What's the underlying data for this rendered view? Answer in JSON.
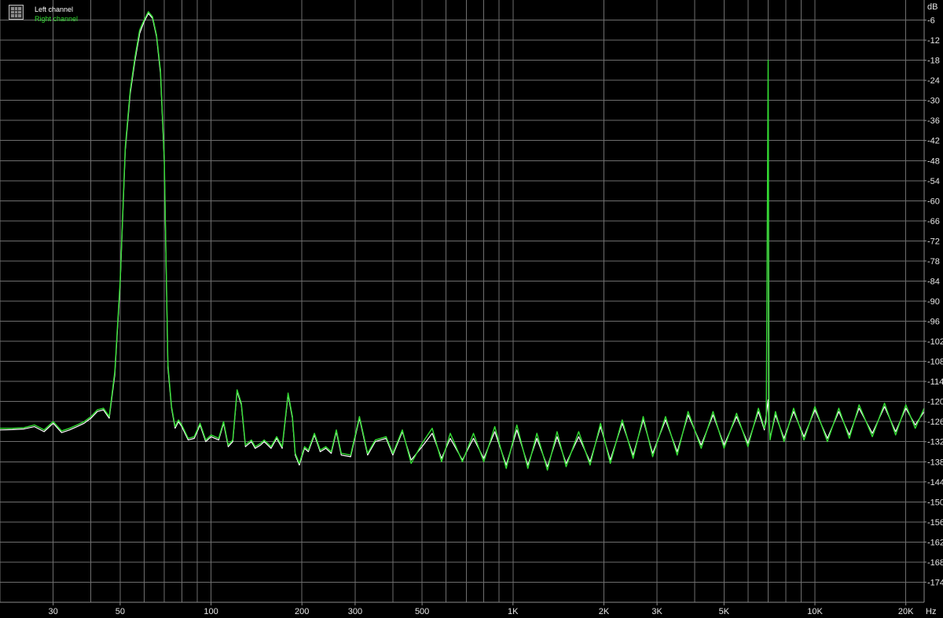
{
  "chart_data": {
    "type": "line",
    "x_scale": "log",
    "xlim": [
      20,
      23000
    ],
    "ylim": [
      -180,
      0
    ],
    "grid": true,
    "legend_position": "top-left",
    "xunit": "Hz",
    "yunit": "dB",
    "x_ticks": [
      {
        "value": 30,
        "label": "30"
      },
      {
        "value": 50,
        "label": "50"
      },
      {
        "value": 100,
        "label": "100"
      },
      {
        "value": 200,
        "label": "200"
      },
      {
        "value": 300,
        "label": "300"
      },
      {
        "value": 500,
        "label": "500"
      },
      {
        "value": 1000,
        "label": "1K"
      },
      {
        "value": 2000,
        "label": "2K"
      },
      {
        "value": 3000,
        "label": "3K"
      },
      {
        "value": 5000,
        "label": "5K"
      },
      {
        "value": 10000,
        "label": "10K"
      },
      {
        "value": 20000,
        "label": "20K"
      }
    ],
    "y_ticks": [
      -6,
      -12,
      -18,
      -24,
      -30,
      -36,
      -42,
      -48,
      -54,
      -60,
      -66,
      -72,
      -78,
      -84,
      -90,
      -96,
      -102,
      -108,
      -114,
      -120,
      -126,
      -132,
      -138,
      -144,
      -150,
      -156,
      -162,
      -168,
      -174
    ],
    "series": [
      {
        "name": "Left channel",
        "color": "#ffffff",
        "points": [
          [
            20,
            -128.5
          ],
          [
            22,
            -128.4
          ],
          [
            24,
            -128.2
          ],
          [
            26,
            -127.5
          ],
          [
            28,
            -129.0
          ],
          [
            30,
            -126.5
          ],
          [
            32,
            -129.3
          ],
          [
            34,
            -128.5
          ],
          [
            36,
            -127.5
          ],
          [
            38,
            -126.5
          ],
          [
            40,
            -125.0
          ],
          [
            42,
            -123.0
          ],
          [
            44,
            -122.5
          ],
          [
            46,
            -125.0
          ],
          [
            48,
            -112.0
          ],
          [
            50,
            -85.0
          ],
          [
            52,
            -45.0
          ],
          [
            54,
            -28.0
          ],
          [
            56,
            -18.0
          ],
          [
            58,
            -10.0
          ],
          [
            60,
            -6.5
          ],
          [
            62,
            -4.0
          ],
          [
            64,
            -5.5
          ],
          [
            66,
            -11.0
          ],
          [
            68,
            -22.0
          ],
          [
            70,
            -48.0
          ],
          [
            72,
            -110.0
          ],
          [
            74,
            -122.0
          ],
          [
            76,
            -128.0
          ],
          [
            78,
            -126.0
          ],
          [
            80,
            -127.5
          ],
          [
            84,
            -131.5
          ],
          [
            88,
            -131.0
          ],
          [
            92,
            -127.0
          ],
          [
            96,
            -132.0
          ],
          [
            100,
            -130.5
          ],
          [
            106,
            -131.5
          ],
          [
            110,
            -126.5
          ],
          [
            114,
            -133.5
          ],
          [
            118,
            -132.0
          ],
          [
            122,
            -117.0
          ],
          [
            126,
            -121.0
          ],
          [
            130,
            -133.5
          ],
          [
            136,
            -132.0
          ],
          [
            140,
            -134.0
          ],
          [
            146,
            -133.0
          ],
          [
            150,
            -132.0
          ],
          [
            158,
            -134.0
          ],
          [
            165,
            -131.0
          ],
          [
            172,
            -134.0
          ],
          [
            180,
            -118.0
          ],
          [
            186,
            -125.0
          ],
          [
            190,
            -136.0
          ],
          [
            196,
            -139.0
          ],
          [
            204,
            -134.0
          ],
          [
            210,
            -135.0
          ],
          [
            220,
            -130.0
          ],
          [
            230,
            -135.0
          ],
          [
            240,
            -134.0
          ],
          [
            250,
            -135.5
          ],
          [
            260,
            -129.0
          ],
          [
            270,
            -136.0
          ],
          [
            290,
            -136.5
          ],
          [
            310,
            -125.0
          ],
          [
            330,
            -136.0
          ],
          [
            350,
            -132.0
          ],
          [
            380,
            -131.0
          ],
          [
            400,
            -136.0
          ],
          [
            430,
            -129.0
          ],
          [
            460,
            -137.5
          ],
          [
            500,
            -133.5
          ],
          [
            540,
            -129.5
          ],
          [
            580,
            -137.0
          ],
          [
            620,
            -131.0
          ],
          [
            680,
            -137.5
          ],
          [
            740,
            -131.0
          ],
          [
            800,
            -137.0
          ],
          [
            870,
            -129.0
          ],
          [
            950,
            -139.0
          ],
          [
            1030,
            -128.5
          ],
          [
            1120,
            -139.0
          ],
          [
            1200,
            -131.0
          ],
          [
            1300,
            -139.5
          ],
          [
            1400,
            -130.5
          ],
          [
            1500,
            -138.5
          ],
          [
            1650,
            -130.5
          ],
          [
            1800,
            -138.0
          ],
          [
            1950,
            -127.5
          ],
          [
            2100,
            -137.5
          ],
          [
            2300,
            -126.5
          ],
          [
            2500,
            -136.0
          ],
          [
            2700,
            -125.5
          ],
          [
            2900,
            -135.5
          ],
          [
            3200,
            -125.5
          ],
          [
            3500,
            -135.0
          ],
          [
            3800,
            -124.0
          ],
          [
            4200,
            -133.0
          ],
          [
            4600,
            -124.0
          ],
          [
            5000,
            -133.0
          ],
          [
            5500,
            -124.5
          ],
          [
            6000,
            -132.5
          ],
          [
            6500,
            -123.0
          ],
          [
            6800,
            -128.5
          ],
          [
            7000,
            -119.5
          ],
          [
            7100,
            -131.0
          ],
          [
            7400,
            -124.0
          ],
          [
            7900,
            -131.0
          ],
          [
            8500,
            -123.0
          ],
          [
            9200,
            -130.5
          ],
          [
            10000,
            -122.5
          ],
          [
            11000,
            -131.0
          ],
          [
            12000,
            -123.0
          ],
          [
            13000,
            -130.0
          ],
          [
            14000,
            -122.0
          ],
          [
            15500,
            -129.5
          ],
          [
            17000,
            -121.5
          ],
          [
            18500,
            -129.0
          ],
          [
            20000,
            -122.0
          ],
          [
            21500,
            -127.0
          ],
          [
            23000,
            -123.0
          ]
        ]
      },
      {
        "name": "Right channel",
        "color": "#33dd33",
        "points": [
          [
            20,
            -128.0
          ],
          [
            22,
            -128.0
          ],
          [
            24,
            -127.8
          ],
          [
            26,
            -127.0
          ],
          [
            28,
            -128.5
          ],
          [
            30,
            -126.0
          ],
          [
            32,
            -128.8
          ],
          [
            34,
            -128.0
          ],
          [
            36,
            -127.0
          ],
          [
            38,
            -126.0
          ],
          [
            40,
            -124.5
          ],
          [
            42,
            -122.5
          ],
          [
            44,
            -122.0
          ],
          [
            46,
            -124.5
          ],
          [
            48,
            -111.0
          ],
          [
            50,
            -84.0
          ],
          [
            52,
            -44.0
          ],
          [
            54,
            -27.0
          ],
          [
            56,
            -17.0
          ],
          [
            58,
            -9.0
          ],
          [
            60,
            -6.0
          ],
          [
            62,
            -3.5
          ],
          [
            64,
            -5.0
          ],
          [
            66,
            -10.5
          ],
          [
            68,
            -21.0
          ],
          [
            70,
            -47.0
          ],
          [
            72,
            -109.0
          ],
          [
            74,
            -121.5
          ],
          [
            76,
            -127.5
          ],
          [
            78,
            -125.5
          ],
          [
            80,
            -127.0
          ],
          [
            84,
            -131.0
          ],
          [
            88,
            -130.5
          ],
          [
            92,
            -126.5
          ],
          [
            96,
            -131.5
          ],
          [
            100,
            -130.0
          ],
          [
            106,
            -131.0
          ],
          [
            110,
            -126.0
          ],
          [
            114,
            -133.0
          ],
          [
            118,
            -131.5
          ],
          [
            122,
            -116.5
          ],
          [
            126,
            -120.5
          ],
          [
            130,
            -133.0
          ],
          [
            136,
            -131.5
          ],
          [
            140,
            -133.5
          ],
          [
            146,
            -132.5
          ],
          [
            150,
            -131.5
          ],
          [
            158,
            -133.5
          ],
          [
            165,
            -130.5
          ],
          [
            172,
            -133.5
          ],
          [
            180,
            -117.5
          ],
          [
            186,
            -124.5
          ],
          [
            190,
            -135.5
          ],
          [
            196,
            -138.5
          ],
          [
            204,
            -133.5
          ],
          [
            210,
            -134.5
          ],
          [
            220,
            -129.5
          ],
          [
            230,
            -134.5
          ],
          [
            240,
            -133.5
          ],
          [
            250,
            -135.0
          ],
          [
            260,
            -128.5
          ],
          [
            270,
            -135.5
          ],
          [
            290,
            -136.0
          ],
          [
            310,
            -124.5
          ],
          [
            330,
            -135.5
          ],
          [
            350,
            -131.5
          ],
          [
            380,
            -130.5
          ],
          [
            400,
            -135.5
          ],
          [
            430,
            -128.5
          ],
          [
            460,
            -138.5
          ],
          [
            500,
            -132.5
          ],
          [
            540,
            -128.0
          ],
          [
            580,
            -138.0
          ],
          [
            620,
            -129.5
          ],
          [
            680,
            -138.0
          ],
          [
            740,
            -129.5
          ],
          [
            800,
            -138.0
          ],
          [
            870,
            -127.5
          ],
          [
            950,
            -140.0
          ],
          [
            1030,
            -127.0
          ],
          [
            1120,
            -140.0
          ],
          [
            1200,
            -129.5
          ],
          [
            1300,
            -140.5
          ],
          [
            1400,
            -129.0
          ],
          [
            1500,
            -139.5
          ],
          [
            1650,
            -129.0
          ],
          [
            1800,
            -139.0
          ],
          [
            1950,
            -126.5
          ],
          [
            2100,
            -138.5
          ],
          [
            2300,
            -125.5
          ],
          [
            2500,
            -137.0
          ],
          [
            2700,
            -124.5
          ],
          [
            2900,
            -136.5
          ],
          [
            3200,
            -124.5
          ],
          [
            3500,
            -136.0
          ],
          [
            3800,
            -123.0
          ],
          [
            4200,
            -134.0
          ],
          [
            4600,
            -123.0
          ],
          [
            5000,
            -134.0
          ],
          [
            5500,
            -123.5
          ],
          [
            6000,
            -133.5
          ],
          [
            6500,
            -122.0
          ],
          [
            6800,
            -128.0
          ],
          [
            6900,
            -126.0
          ],
          [
            7000,
            -18.0
          ],
          [
            7050,
            -126.0
          ],
          [
            7100,
            -131.5
          ],
          [
            7400,
            -123.0
          ],
          [
            7900,
            -132.0
          ],
          [
            8500,
            -122.0
          ],
          [
            9200,
            -131.5
          ],
          [
            10000,
            -121.5
          ],
          [
            11000,
            -132.0
          ],
          [
            12000,
            -122.0
          ],
          [
            13000,
            -131.0
          ],
          [
            14000,
            -121.0
          ],
          [
            15500,
            -130.5
          ],
          [
            17000,
            -120.5
          ],
          [
            18500,
            -130.0
          ],
          [
            20000,
            -121.0
          ],
          [
            21500,
            -128.0
          ],
          [
            23000,
            -122.0
          ]
        ]
      }
    ]
  }
}
